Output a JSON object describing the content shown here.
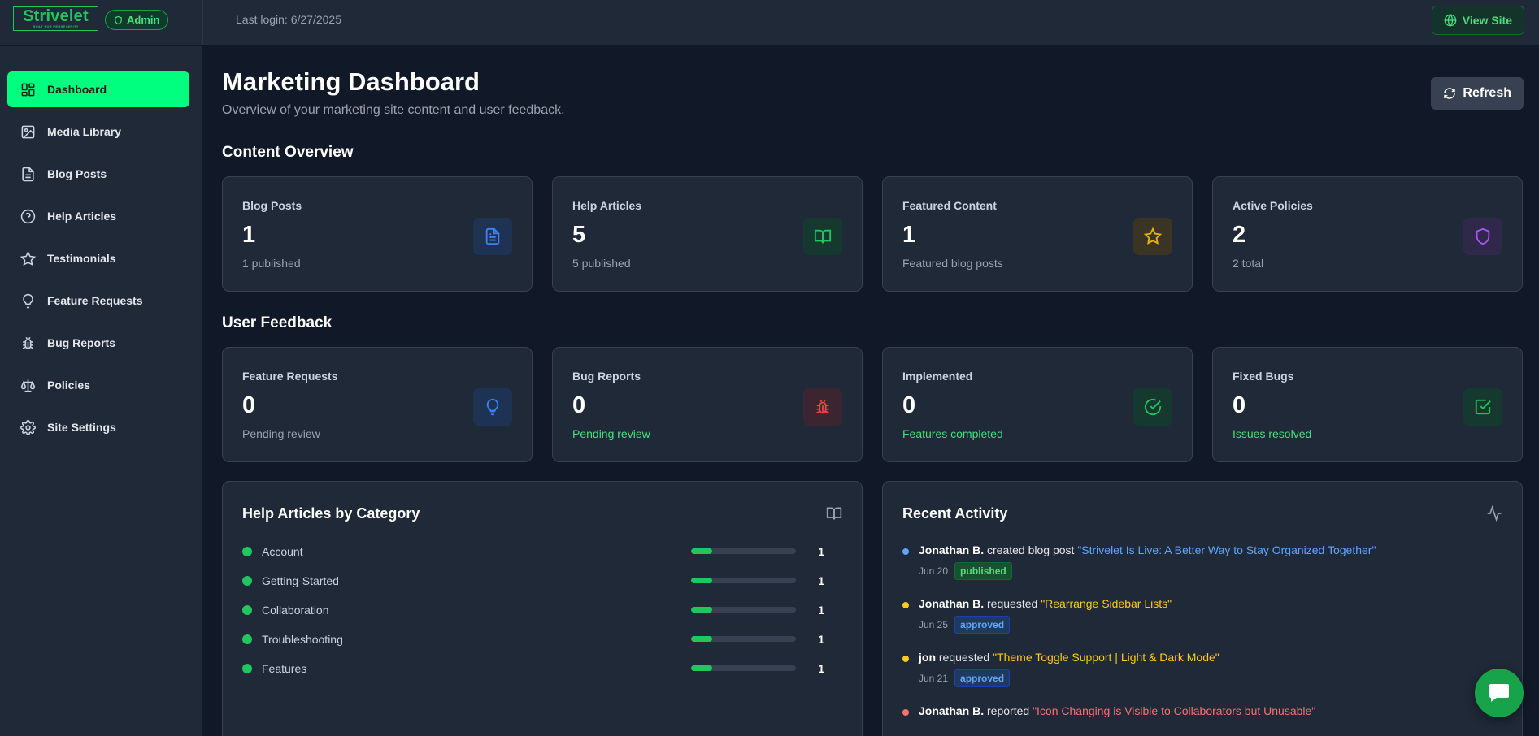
{
  "brand": {
    "name": "Strivelet",
    "tagline": "BUILT FOR PERSEVERITY",
    "role_badge": "Admin"
  },
  "header": {
    "last_login": "Last login: 6/27/2025",
    "view_site_label": "View Site"
  },
  "sidebar": {
    "items": [
      {
        "label": "Dashboard",
        "icon": "dashboard-grid-icon",
        "active": true
      },
      {
        "label": "Media Library",
        "icon": "image-icon"
      },
      {
        "label": "Blog Posts",
        "icon": "document-icon"
      },
      {
        "label": "Help Articles",
        "icon": "help-circle-icon"
      },
      {
        "label": "Testimonials",
        "icon": "star-icon"
      },
      {
        "label": "Feature Requests",
        "icon": "lightbulb-icon"
      },
      {
        "label": "Bug Reports",
        "icon": "bug-icon"
      },
      {
        "label": "Policies",
        "icon": "scale-icon"
      },
      {
        "label": "Site Settings",
        "icon": "gear-icon"
      }
    ]
  },
  "page": {
    "title": "Marketing Dashboard",
    "subtitle": "Overview of your marketing site content and user feedback.",
    "refresh_label": "Refresh"
  },
  "content_overview": {
    "title": "Content Overview",
    "cards": [
      {
        "label": "Blog Posts",
        "value": "1",
        "sub": "1 published",
        "icon": "document-icon",
        "color": "#3b82f6"
      },
      {
        "label": "Help Articles",
        "value": "5",
        "sub": "5 published",
        "icon": "book-open-icon",
        "color": "#22c55e"
      },
      {
        "label": "Featured Content",
        "value": "1",
        "sub": "Featured blog posts",
        "icon": "star-icon",
        "color": "#eab308"
      },
      {
        "label": "Active Policies",
        "value": "2",
        "sub": "2 total",
        "icon": "shield-icon",
        "color": "#a855f7"
      }
    ]
  },
  "user_feedback": {
    "title": "User Feedback",
    "cards": [
      {
        "label": "Feature Requests",
        "value": "0",
        "sub": "Pending review",
        "icon": "lightbulb-icon",
        "color": "#3b82f6"
      },
      {
        "label": "Bug Reports",
        "value": "0",
        "sub": "Pending review",
        "icon": "bug-icon",
        "color": "#ef4444"
      },
      {
        "label": "Implemented",
        "value": "0",
        "sub": "Features completed",
        "icon": "check-circle-icon",
        "color": "#22c55e"
      },
      {
        "label": "Fixed Bugs",
        "value": "0",
        "sub": "Issues resolved",
        "icon": "check-square-icon",
        "color": "#22c55e"
      }
    ]
  },
  "help_categories": {
    "title": "Help Articles by Category",
    "items": [
      {
        "name": "Account",
        "count": "1",
        "fraction": 0.2
      },
      {
        "name": "Getting-Started",
        "count": "1",
        "fraction": 0.2
      },
      {
        "name": "Collaboration",
        "count": "1",
        "fraction": 0.2
      },
      {
        "name": "Troubleshooting",
        "count": "1",
        "fraction": 0.2
      },
      {
        "name": "Features",
        "count": "1",
        "fraction": 0.2
      }
    ]
  },
  "recent_activity": {
    "title": "Recent Activity",
    "items": [
      {
        "user": "Jonathan B.",
        "action": "created blog post",
        "target": "\"Strivelet Is Live: A Better Way to Stay Organized Together\"",
        "date": "Jun 20",
        "status": "published",
        "color": "#60a5fa"
      },
      {
        "user": "Jonathan B.",
        "action": "requested",
        "target": "\"Rearrange Sidebar Lists\"",
        "date": "Jun 25",
        "status": "approved",
        "color": "#facc15"
      },
      {
        "user": "jon",
        "action": "requested",
        "target": "\"Theme Toggle Support | Light & Dark Mode\"",
        "date": "Jun 21",
        "status": "approved",
        "color": "#facc15"
      },
      {
        "user": "Jonathan B.",
        "action": "reported",
        "target": "\"Icon Changing is Visible to Collaborators but Unusable\"",
        "date": "",
        "status": "",
        "color": "#f87171"
      }
    ]
  },
  "chat": {
    "icon": "chat-bubble-icon"
  }
}
